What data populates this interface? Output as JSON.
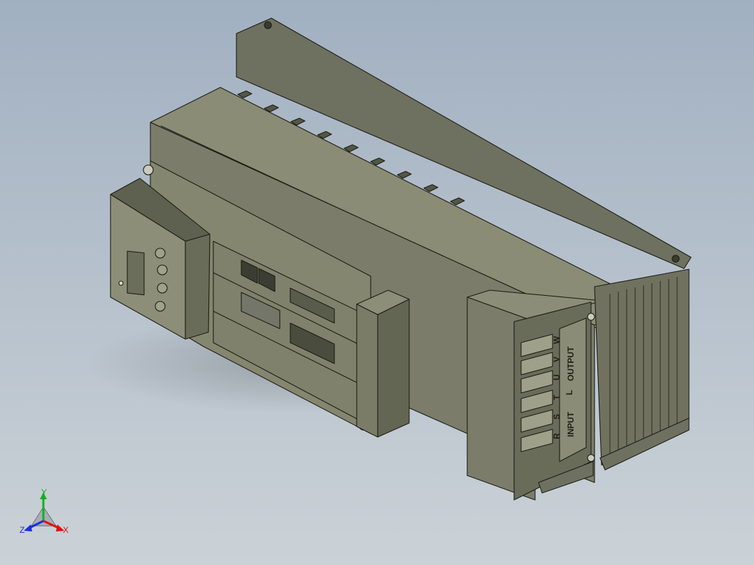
{
  "scene": {
    "background_top": "#a6b4c4",
    "background_bottom": "#c8d0d6",
    "body_color": "#7b7d6a",
    "body_dark": "#5d5f4e",
    "body_light": "#9a9c86",
    "edge_color": "#1c1d14"
  },
  "terminal_block": {
    "output_label": "OUTPUT",
    "input_label": "INPUT",
    "terminal_letters": [
      "W",
      "V",
      "U",
      "T",
      "S",
      "R"
    ],
    "divider_label": "L"
  },
  "triad": {
    "x_label": "X",
    "y_label": "Y",
    "z_label": "Z",
    "x_color": "#e01010",
    "y_color": "#10b020",
    "z_color": "#1a2fd8"
  }
}
